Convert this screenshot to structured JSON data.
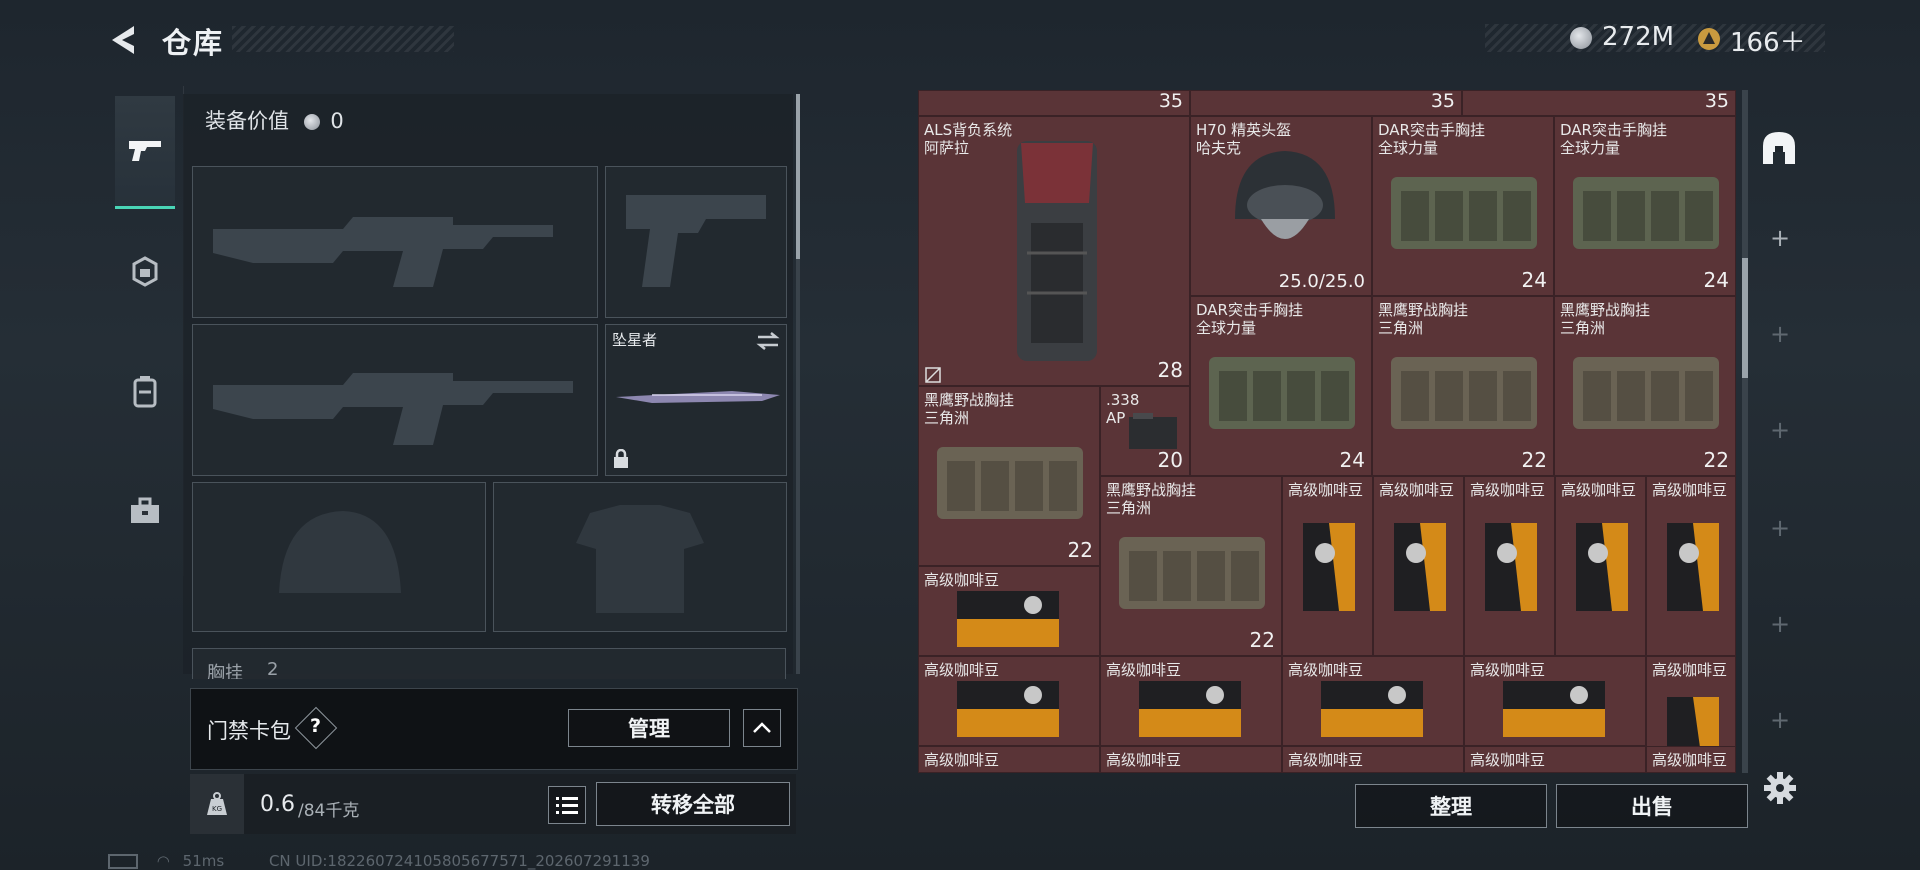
{
  "header": {
    "back_icon": "back-arrow-icon",
    "title": "仓库",
    "currency_silver": "272M",
    "currency_gold": "166＋",
    "silver_color": "#b8bcc2",
    "gold_color": "#d0a24a"
  },
  "tabs": [
    {
      "icon": "pistol-icon",
      "active": true
    },
    {
      "icon": "helmet-icon",
      "active": false
    },
    {
      "icon": "backpack-icon",
      "active": false
    },
    {
      "icon": "toolbox-icon",
      "active": false
    }
  ],
  "loadout": {
    "equip_value_label": "装备价值",
    "equip_value": "0",
    "melee_name": "坠星者",
    "next_section": "胸挂",
    "next_section_count": "2"
  },
  "access": {
    "label": "门禁卡包",
    "help": "?",
    "manage": "管理"
  },
  "weight": {
    "current": "0.6",
    "max": "/84千克",
    "kg_icon": "KG",
    "transfer_all": "转移全部"
  },
  "grid": {
    "top_counts": [
      "35",
      "35",
      "35"
    ],
    "items": [
      {
        "name": "ALS背负系统\n阿萨拉",
        "count": "28"
      },
      {
        "name": "H70 精英头盔\n哈夫克",
        "count": "25.0/25.0"
      },
      {
        "name": "DAR突击手胸挂\n全球力量",
        "count": "24"
      },
      {
        "name": "DAR突击手胸挂\n全球力量",
        "count": "24"
      },
      {
        "name": "DAR突击手胸挂\n全球力量",
        "count": "24"
      },
      {
        "name": "黑鹰野战胸挂\n三角洲",
        "count": "22"
      },
      {
        "name": "黑鹰野战胸挂\n三角洲",
        "count": "22"
      },
      {
        "name": "黑鹰野战胸挂\n三角洲",
        "count": "22"
      },
      {
        "name": ".338\nAP",
        "count": "20"
      },
      {
        "name": "黑鹰野战胸挂\n三角洲",
        "count": "22"
      },
      {
        "name": "高级咖啡豆",
        "count": ""
      },
      {
        "name": "高级咖啡豆",
        "count": ""
      },
      {
        "name": "高级咖啡豆",
        "count": ""
      },
      {
        "name": "高级咖啡豆",
        "count": ""
      },
      {
        "name": "高级咖啡豆",
        "count": ""
      },
      {
        "name": "高级咖啡豆",
        "count": ""
      },
      {
        "name": "高级咖啡豆",
        "count": ""
      },
      {
        "name": "高级咖啡豆",
        "count": ""
      },
      {
        "name": "高级咖啡豆",
        "count": ""
      },
      {
        "name": "高级咖啡豆",
        "count": ""
      },
      {
        "name": "高级咖啡豆",
        "count": ""
      },
      {
        "name": "高级咖啡豆",
        "count": ""
      },
      {
        "name": "高级咖啡豆",
        "count": ""
      },
      {
        "name": "高级咖啡豆",
        "count": ""
      },
      {
        "name": "高级咖啡豆",
        "count": ""
      },
      {
        "name": "高级咖啡豆",
        "count": ""
      }
    ]
  },
  "actions": {
    "sort": "整理",
    "sell": "出售"
  },
  "status": {
    "ping": "51ms",
    "uid": "CN UID:18226072410580567757​1_202607291139"
  }
}
